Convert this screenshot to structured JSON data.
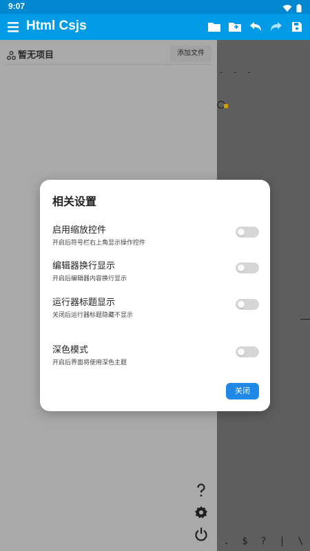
{
  "status": {
    "time": "9:07"
  },
  "app": {
    "title": "Html Csjs"
  },
  "toolbar": {
    "icons": [
      "open-folder-icon",
      "new-folder-icon",
      "undo-icon",
      "redo-icon",
      "save-icon"
    ]
  },
  "file_panel": {
    "project_label": "暂无项目",
    "add_file_label": "添加文件"
  },
  "editor": {
    "dash_text": "- - -",
    "keys": [
      ".",
      "$",
      "?",
      "|",
      "\\"
    ]
  },
  "dialog": {
    "title": "相关设置",
    "settings": [
      {
        "label": "启用缩放控件",
        "desc": "开启后符号栏右上角显示操作控件",
        "enabled": false
      },
      {
        "label": "编辑器换行显示",
        "desc": "开启后编辑器内容换行显示",
        "enabled": false
      },
      {
        "label": "运行器标题显示",
        "desc": "关闭后运行器标题隐藏不显示",
        "enabled": false
      },
      {
        "label": "深色模式",
        "desc": "开启后界面将使用深色主题",
        "enabled": false
      }
    ],
    "close_label": "关闭"
  },
  "colors": {
    "accent": "#039be5",
    "button": "#1e88e5",
    "status_bar": "#0288d1"
  }
}
